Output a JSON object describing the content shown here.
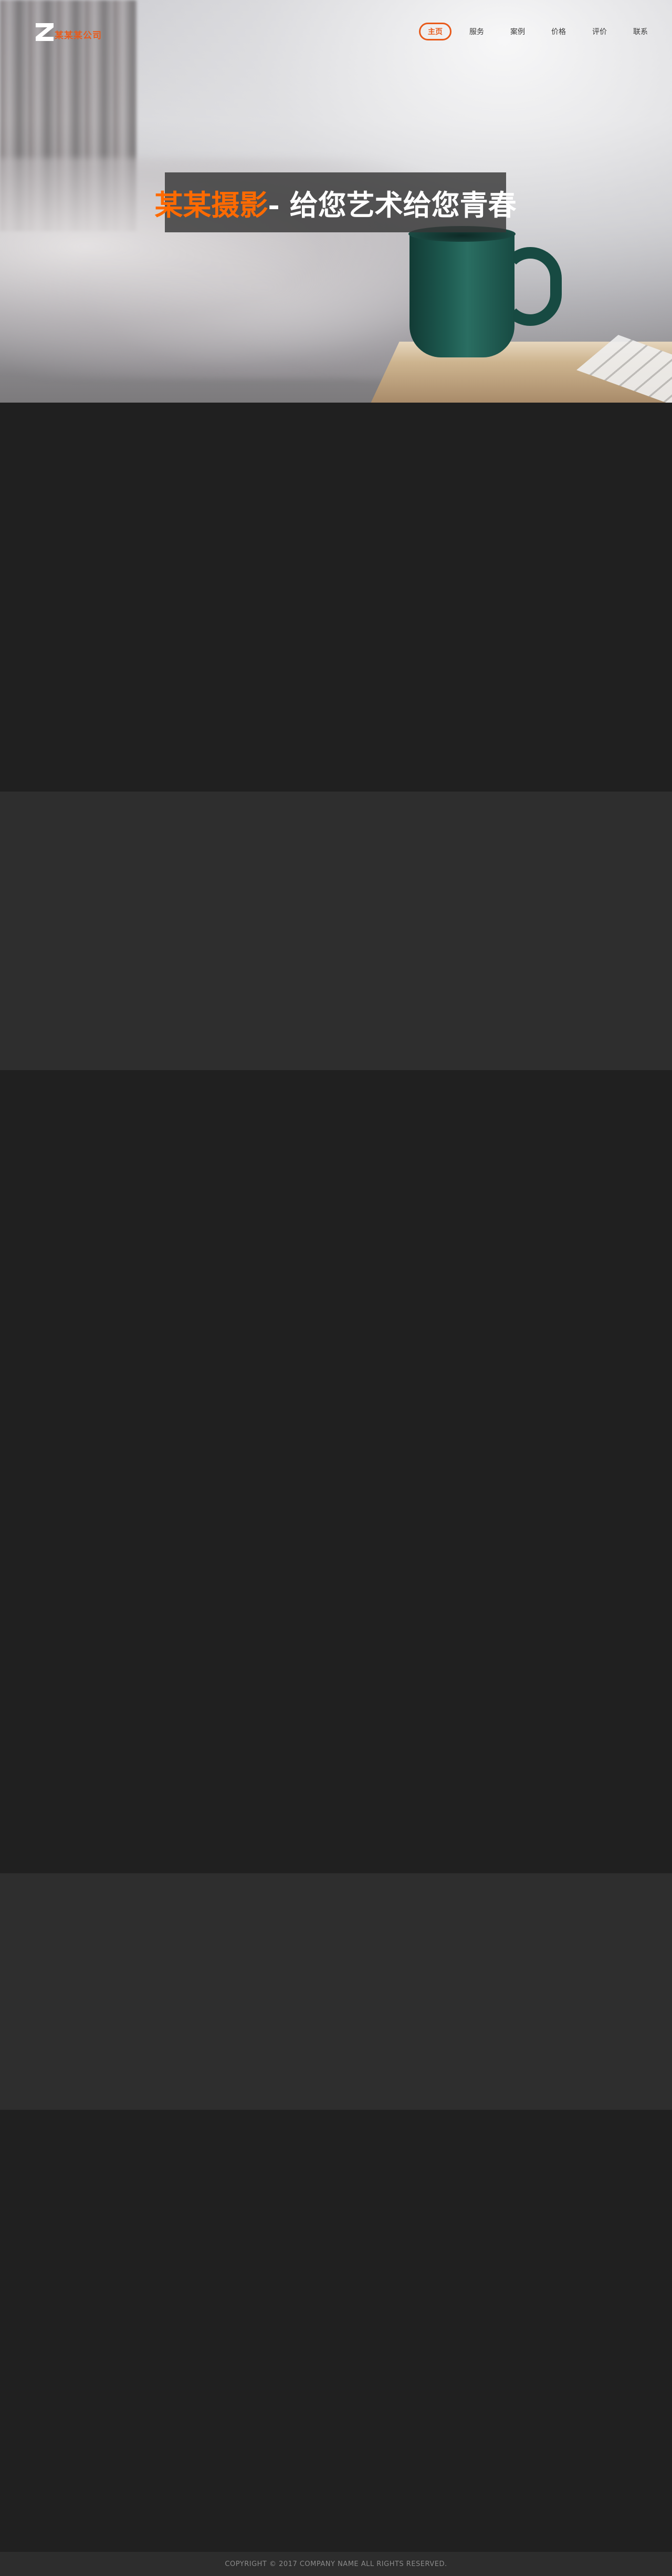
{
  "header": {
    "logo_text": "某某某公司",
    "nav": [
      {
        "label": "主页",
        "active": true
      },
      {
        "label": "服务",
        "active": false
      },
      {
        "label": "案例",
        "active": false
      },
      {
        "label": "价格",
        "active": false
      },
      {
        "label": "评价",
        "active": false
      },
      {
        "label": "联系",
        "active": false
      }
    ]
  },
  "hero": {
    "title_accent": "某某摄影",
    "title_rest": " - 给您艺术给您青春"
  },
  "footer": {
    "copyright": "COPYRIGHT © 2017 COMPANY NAME ALL RIGHTS RESERVED."
  },
  "colors": {
    "accent": "#e85a1b",
    "hero_accent": "#ff6a00",
    "dark_section": "#202020",
    "light_section": "#2e2e2e"
  }
}
